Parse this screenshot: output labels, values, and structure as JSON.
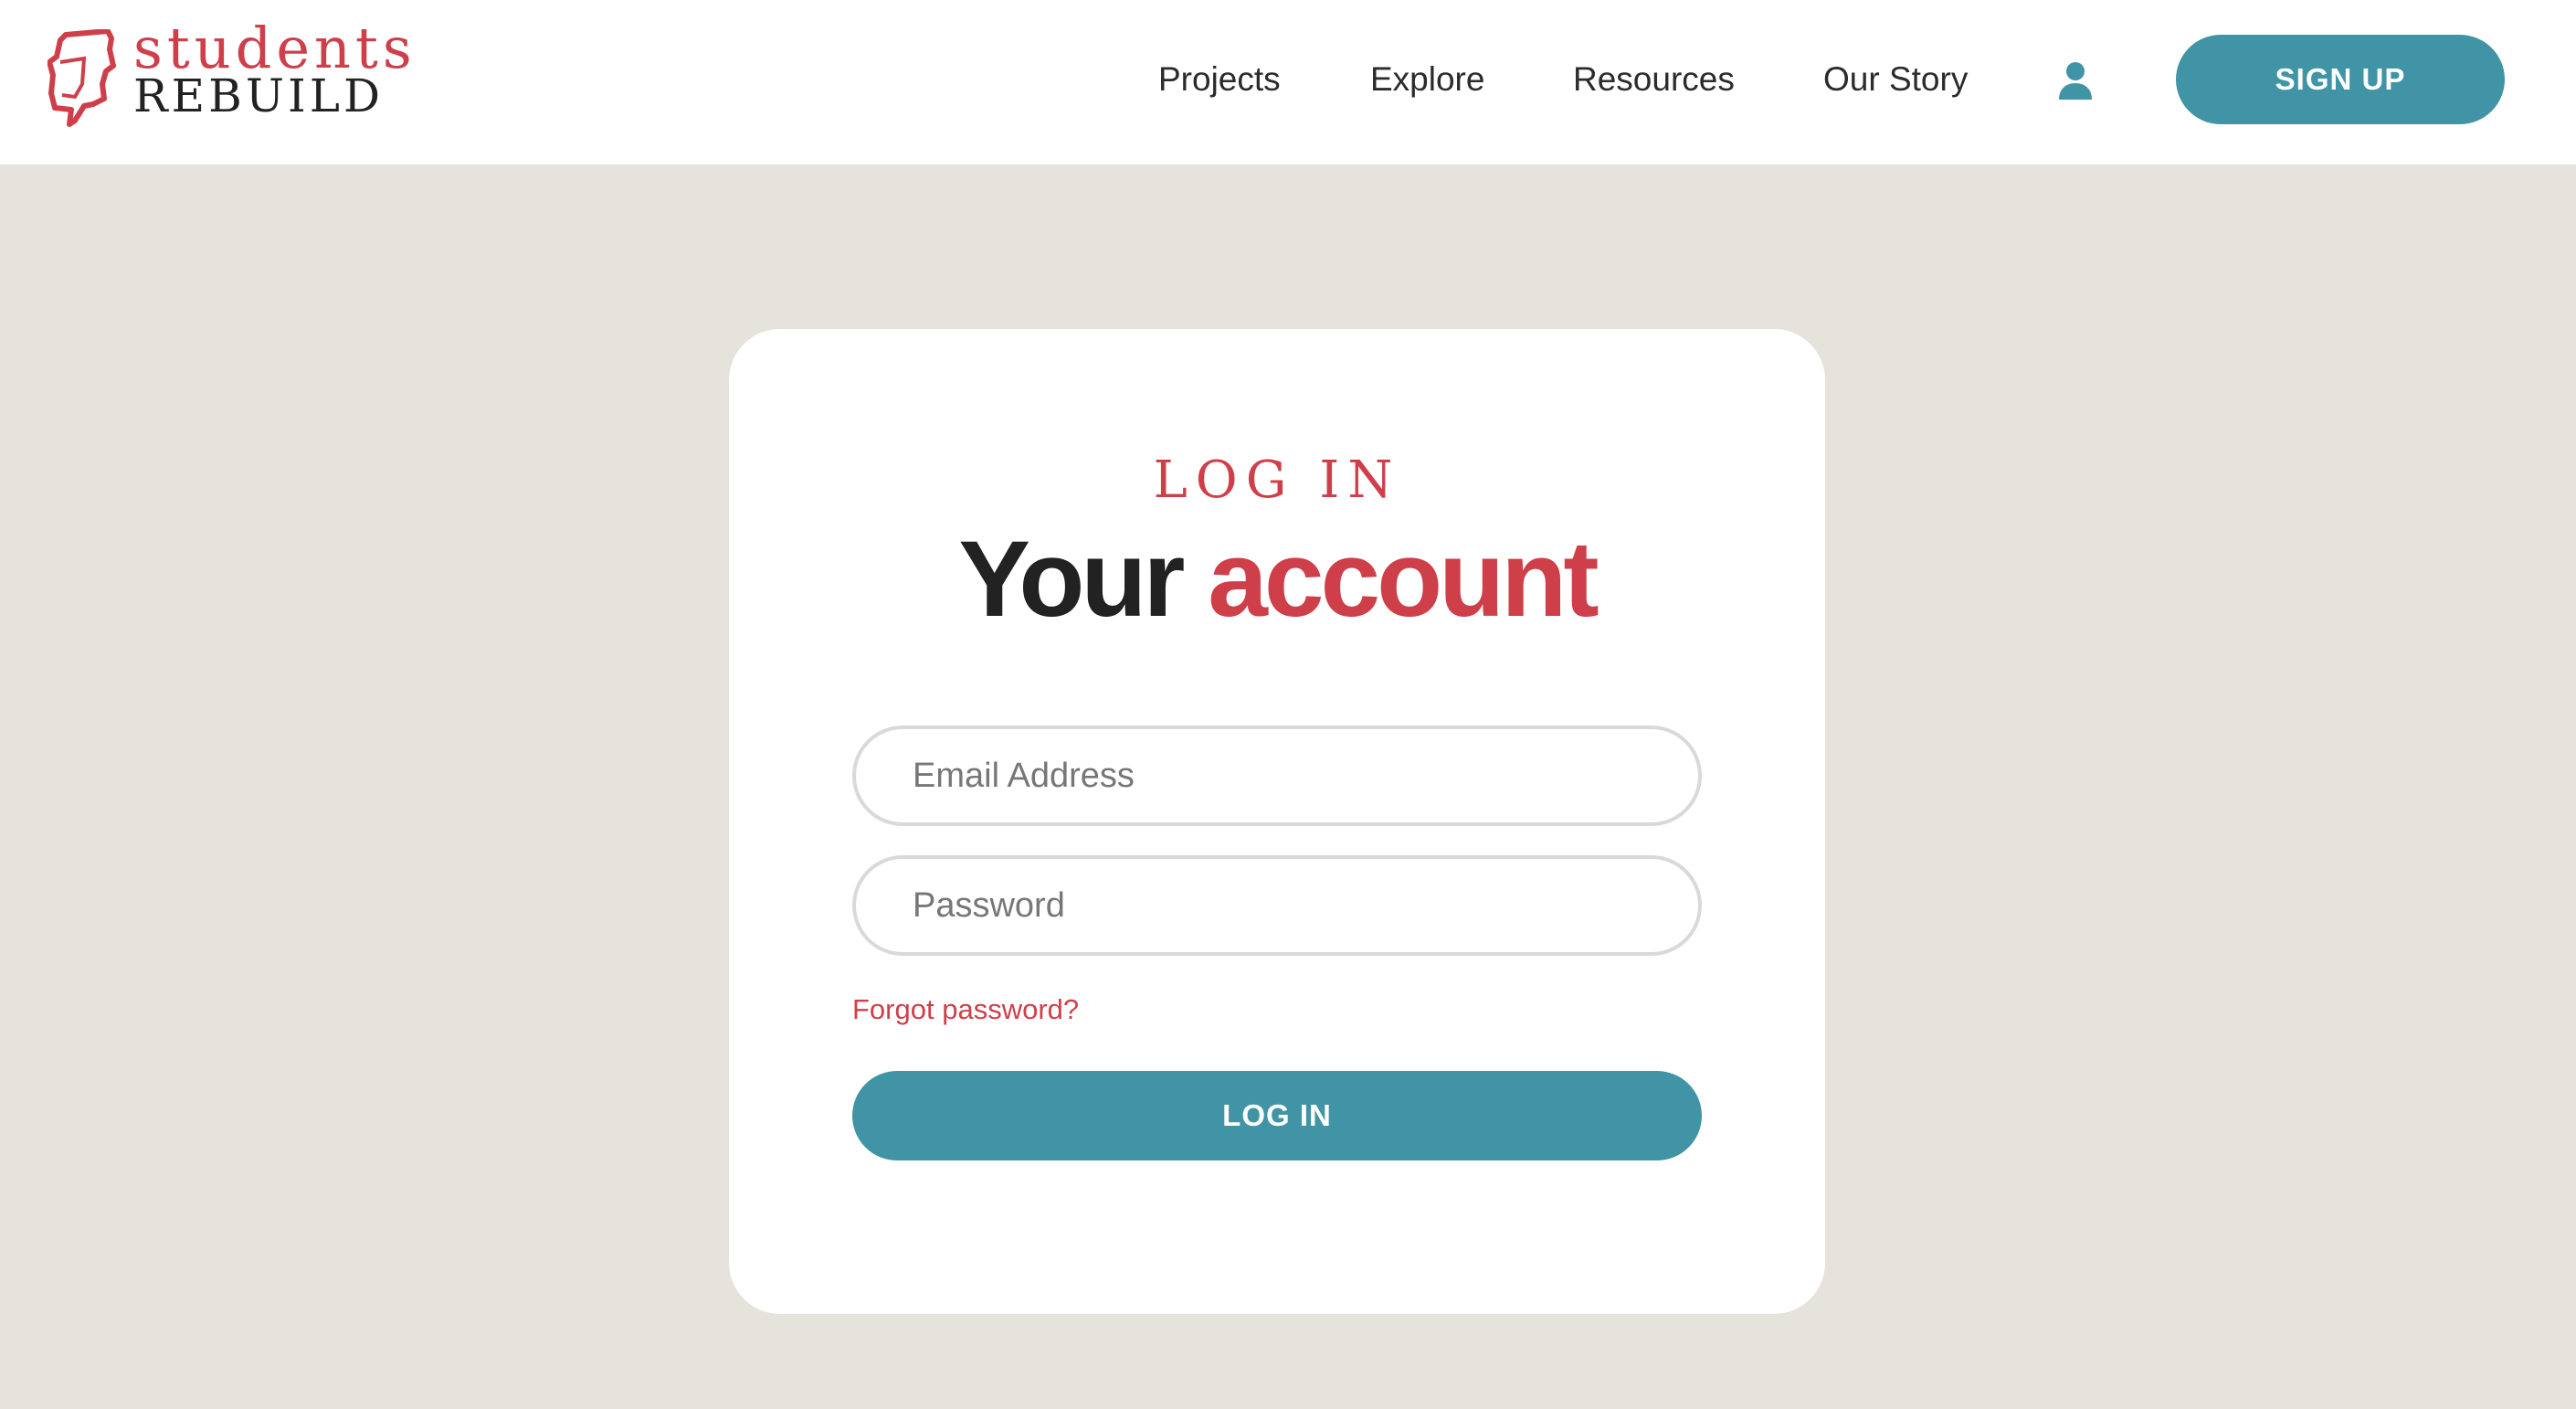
{
  "brand": {
    "line1": "students",
    "line2": "REBUILD",
    "primary_color": "#cf3f4a",
    "accent_color": "#4194a5",
    "logo_icon": "torn-square-logo-icon"
  },
  "nav": {
    "items": [
      {
        "label": "Projects"
      },
      {
        "label": "Explore"
      },
      {
        "label": "Resources"
      },
      {
        "label": "Our Story"
      }
    ],
    "account_icon": "user-icon",
    "signup_label": "SIGN UP"
  },
  "login_card": {
    "eyebrow": "LOG IN",
    "title_part1": "Your",
    "title_part2": "account",
    "email_placeholder": "Email Address",
    "email_value": "",
    "password_placeholder": "Password",
    "password_value": "",
    "forgot_label": "Forgot password?",
    "submit_label": "LOG IN"
  }
}
